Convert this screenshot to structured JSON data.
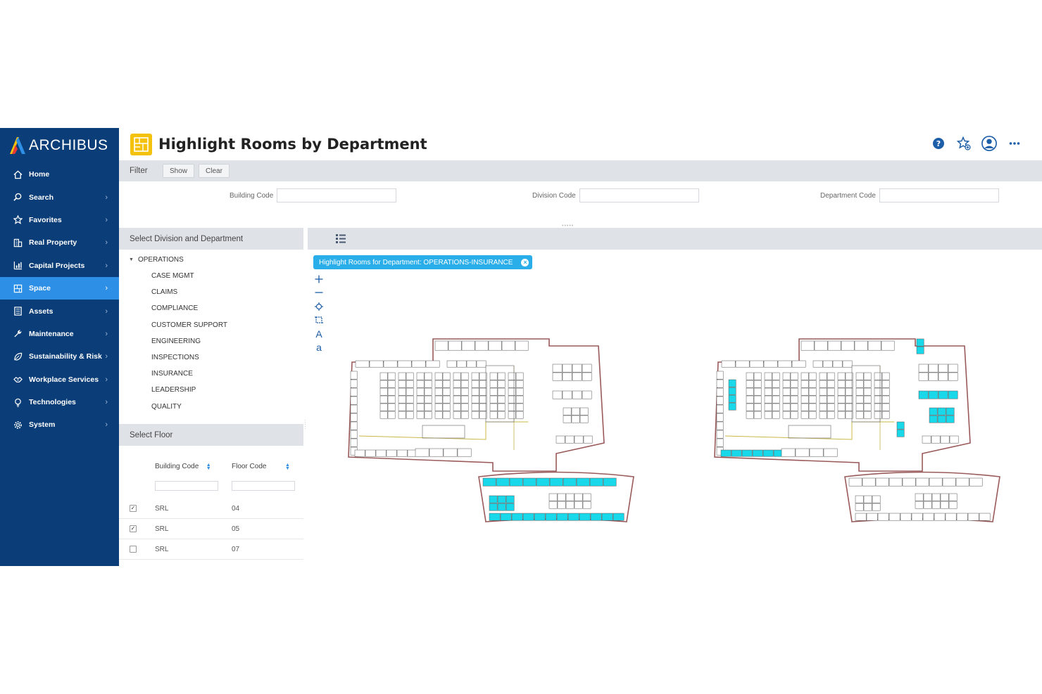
{
  "app": {
    "brand": "ARCHIBUS",
    "title": "Highlight Rooms by Department"
  },
  "sidebar": {
    "items": [
      {
        "label": "Home",
        "icon": "home-icon",
        "has_chevron": false,
        "active": false
      },
      {
        "label": "Search",
        "icon": "search-icon",
        "has_chevron": true,
        "active": false
      },
      {
        "label": "Favorites",
        "icon": "star-icon",
        "has_chevron": true,
        "active": false
      },
      {
        "label": "Real Property",
        "icon": "building-icon",
        "has_chevron": true,
        "active": false
      },
      {
        "label": "Capital Projects",
        "icon": "chart-icon",
        "has_chevron": true,
        "active": false
      },
      {
        "label": "Space",
        "icon": "floorplan-icon",
        "has_chevron": true,
        "active": true
      },
      {
        "label": "Assets",
        "icon": "assets-icon",
        "has_chevron": true,
        "active": false
      },
      {
        "label": "Maintenance",
        "icon": "wrench-icon",
        "has_chevron": true,
        "active": false
      },
      {
        "label": "Sustainability & Risk",
        "icon": "leaf-icon",
        "has_chevron": true,
        "active": false
      },
      {
        "label": "Workplace Services",
        "icon": "handshake-icon",
        "has_chevron": true,
        "active": false
      },
      {
        "label": "Technologies",
        "icon": "lightbulb-icon",
        "has_chevron": true,
        "active": false
      },
      {
        "label": "System",
        "icon": "gear-icon",
        "has_chevron": true,
        "active": false
      }
    ]
  },
  "header": {
    "tools": [
      "help-icon",
      "favorite-add-icon",
      "user-avatar-icon",
      "more-icon"
    ]
  },
  "filter": {
    "title": "Filter",
    "show_label": "Show",
    "clear_label": "Clear",
    "fields": [
      {
        "label": "Building Code",
        "value": ""
      },
      {
        "label": "Division Code",
        "value": ""
      },
      {
        "label": "Department Code",
        "value": ""
      }
    ]
  },
  "division_panel": {
    "title": "Select Division and Department",
    "root": "OPERATIONS",
    "departments": [
      "CASE MGMT",
      "CLAIMS",
      "COMPLIANCE",
      "CUSTOMER SUPPORT",
      "ENGINEERING",
      "INSPECTIONS",
      "INSURANCE",
      "LEADERSHIP",
      "QUALITY"
    ]
  },
  "floor_panel": {
    "title": "Select Floor",
    "columns": [
      "Building Code",
      "Floor Code"
    ],
    "rows": [
      {
        "building": "SRL",
        "floor": "04",
        "checked": true
      },
      {
        "building": "SRL",
        "floor": "05",
        "checked": true
      },
      {
        "building": "SRL",
        "floor": "07",
        "checked": false
      }
    ]
  },
  "drawing": {
    "tag_label": "Highlight Rooms for Department: OPERATIONS-INSURANCE",
    "tools": [
      "zoom-in-icon",
      "zoom-out-icon",
      "zoom-extents-icon",
      "zoom-window-icon",
      "larger-text-icon",
      "smaller-text-icon"
    ],
    "tool_glyphs": {
      "larger_text": "A",
      "smaller_text": "a"
    },
    "highlight_color": "#18d8ea",
    "accent_color": "#2e8fe6"
  }
}
